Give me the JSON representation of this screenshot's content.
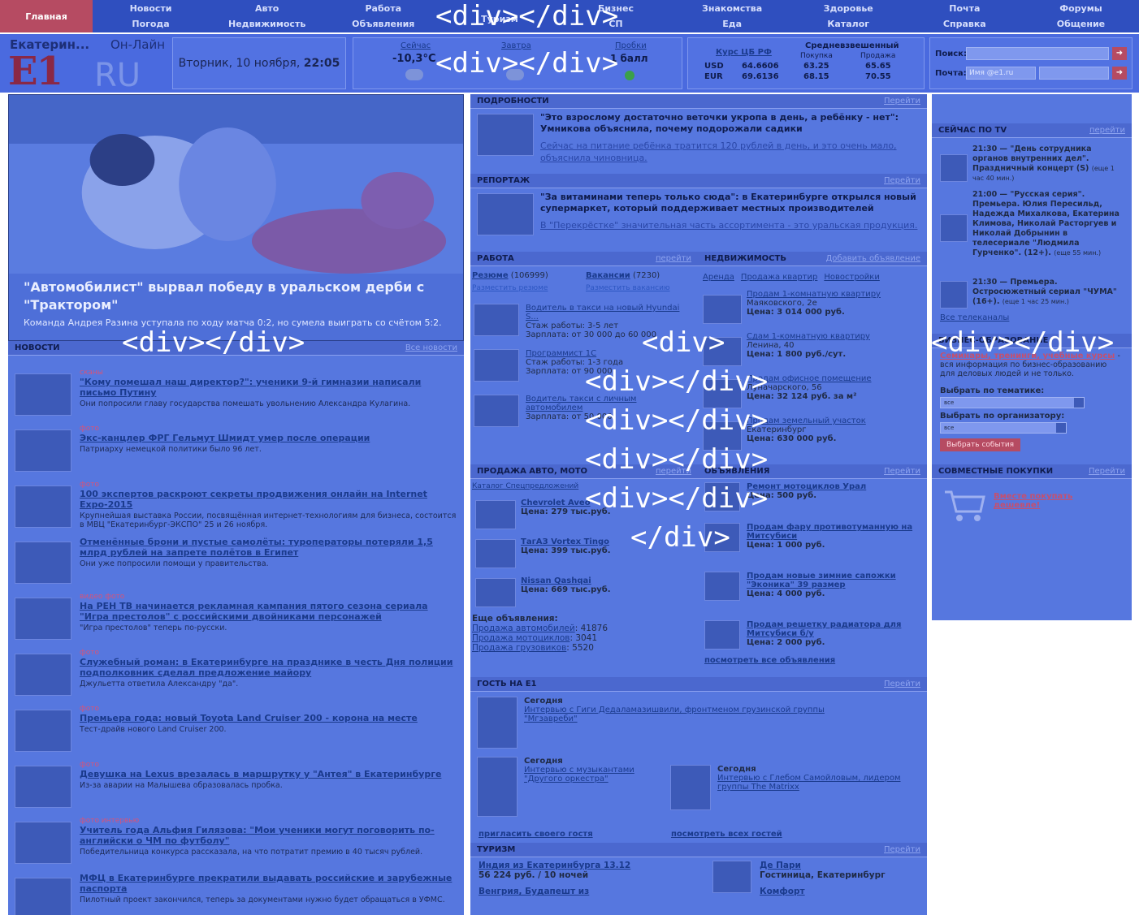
{
  "nav": {
    "home": "Главная",
    "columns": [
      [
        "Новости",
        "Погода"
      ],
      [
        "Авто",
        "Недвижимость"
      ],
      [
        "Работа",
        "Объявления"
      ],
      [
        "",
        "Туризм"
      ],
      [
        "Бизнес",
        "СП"
      ],
      [
        "Знакомства",
        "Еда"
      ],
      [
        "Здоровье",
        "Каталог"
      ],
      [
        "Почта",
        "Справка"
      ],
      [
        "Форумы",
        "Общение"
      ]
    ]
  },
  "header": {
    "city": "Екатерин...",
    "online": "Он-Лайн",
    "logo_e1": "E1",
    "logo_ru": "RU",
    "date": "Вторник, 10 ноября,",
    "time": "22:05",
    "weather": {
      "now_label": "Сейчас",
      "now_temp": "-10,3°C",
      "tomorrow_label": "Завтра",
      "traffic_label": "Пробки",
      "traffic_value": "1 балл"
    },
    "rates": {
      "cb_label": "Курс ЦБ РФ",
      "weighted_label": "Средневзвешенный",
      "buy": "Покупка",
      "sell": "Продажа",
      "rows": [
        {
          "cur": "USD",
          "cb": "64.6606",
          "buy": "63.25",
          "sell": "65.65"
        },
        {
          "cur": "EUR",
          "cb": "69.6136",
          "buy": "68.15",
          "sell": "70.55"
        }
      ]
    },
    "search_label": "Поиск:",
    "mail_label": "Почта:",
    "mail_placeholder": "Имя @e1.ru"
  },
  "hero": {
    "title": "\"Автомобилист\" вырвал победу в уральском дерби с \"Трактором\"",
    "lead": "Команда Андрея Разина уступала по ходу матча 0:2, но сумела выиграть со счётом 5:2."
  },
  "news": {
    "header": "НОВОСТИ",
    "more": "Все новости",
    "items": [
      {
        "tags": "сканы",
        "title": "\"Кому помешал наш директор?\": ученики 9-й гимназии написали письмо Путину",
        "desc": "Они попросили главу государства помешать увольнению Александра Кулагина."
      },
      {
        "tags": "фото",
        "title": "Экс-канцлер ФРГ Гельмут Шмидт умер после операции",
        "desc": "Патриарху немецкой политики было 96 лет."
      },
      {
        "tags": "фото",
        "title": "100 экспертов раскроют секреты продвижения онлайн на Internet Expo-2015",
        "desc": "Крупнейшая выставка России, посвящённая интернет-технологиям для бизнеса, состоится в МВЦ \"Екатеринбург-ЭКСПО\" 25 и 26 ноября."
      },
      {
        "tags": "",
        "title": "Отменённые брони и пустые самолёты: туроператоры потеряли 1,5 млрд рублей на запрете полётов в Египет",
        "desc": "Они уже попросили помощи у правительства."
      },
      {
        "tags": "видео фото",
        "title": "На РЕН ТВ начинается рекламная кампания пятого сезона сериала \"Игра престолов\" с российскими двойниками персонажей",
        "desc": "\"Игра престолов\" теперь по-русски."
      },
      {
        "tags": "фото",
        "title": "Служебный роман: в Екатеринбурге на празднике в честь Дня полиции подполковник сделал предложение майору",
        "desc": "Джульетта ответила Александру \"да\"."
      },
      {
        "tags": "фото",
        "title": "Премьера года: новый Toyota Land Cruiser 200 - корона на месте",
        "desc": "Тест-драйв нового Land Cruiser 200."
      },
      {
        "tags": "фото",
        "title": "Девушка на Lexus врезалась в маршрутку у \"Антея\" в Екатеринбурге",
        "desc": "Из-за аварии на Малышева образовалась пробка."
      },
      {
        "tags": "фото интервью",
        "title": "Учитель года Альфия Гилязова: \"Мои ученики могут поговорить по-английски о ЧМ по футболу\"",
        "desc": "Победительница конкурса рассказала, на что потратит премию в 40 тысяч рублей."
      },
      {
        "tags": "",
        "title": "МФЦ в Екатеринбурге прекратили выдавать российские и зарубежные паспорта",
        "desc": "Пилотный проект закончился, теперь за документами нужно будет обращаться в УФМС."
      }
    ]
  },
  "details": {
    "header": "ПОДРОБНОСТИ",
    "more": "Перейти",
    "title": "\"Это взрослому достаточно веточки укропа в день, а ребёнку - нет\": Умникова объяснила, почему подорожали садики",
    "sub": "Сейчас на питание ребёнка тратится 120 рублей в день, и это очень мало, объяснила чиновница."
  },
  "report": {
    "header": "РЕПОРТАЖ",
    "more": "Перейти",
    "title": "\"За витаминами теперь только сюда\": в Екатеринбурге открылся новый супермаркет, который поддерживает местных производителей",
    "sub": "В \"Перекрёстке\" значительная часть ассортимента - это уральская продукция."
  },
  "work": {
    "header": "РАБОТА",
    "more": "перейти",
    "resume": "Резюме",
    "resume_count": "(106999)",
    "vacancies": "Вакансии",
    "vacancies_count": "(7230)",
    "post_resume": "Разместить резюме",
    "post_vacancy": "Разместить вакансию",
    "jobs": [
      {
        "title": "Водитель в такси на новый Hyundai S...",
        "l1": "Стаж работы: 3-5 лет",
        "l2": "Зарплата: от 30 000 до 60 000"
      },
      {
        "title": "Программист 1С",
        "l1": "Стаж работы: 1-3 года",
        "l2": "Зарплата: от 90 000"
      },
      {
        "title": "Водитель такси с личным автомобилем",
        "l1": "Зарплата: от 50 000",
        "l2": ""
      }
    ]
  },
  "realty": {
    "header": "НЕДВИЖИМОСТЬ",
    "more": "Добавить объявление",
    "tabs": [
      "Аренда",
      "Продажа квартир",
      "Новостройки"
    ],
    "items": [
      {
        "title": "Продам 1-комнатную квартиру",
        "addr": "Маяковского, 2е",
        "price": "Цена: 3 014 000 руб."
      },
      {
        "title": "Сдам 1-комнатную квартиру",
        "addr": "Ленина, 40",
        "price": "Цена: 1 800 руб./сут."
      },
      {
        "title": "Продам офисное помещение",
        "addr": "Луначарского, 56",
        "price": "Цена: 32 124 руб. за м²"
      },
      {
        "title": "Продам земельный участок",
        "addr": "Екатеринбург",
        "price": "Цена: 630 000 руб."
      }
    ]
  },
  "auto": {
    "header": "ПРОДАЖА АВТО, МОТО",
    "more": "перейти",
    "catalog": "Каталог Спецпредложений",
    "cars": [
      {
        "name": "Chevrolet Aveo",
        "price": "Цена: 279 тыс.руб."
      },
      {
        "name": "ТагАЗ Vortex Tingo",
        "price": "Цена: 399 тыс.руб."
      },
      {
        "name": "Nissan Qashqai",
        "price": "Цена: 669 тыс.руб."
      }
    ],
    "more_title": "Еще объявления:",
    "more_links": [
      {
        "label": "Продажа автомобилей",
        "count": ": 41876"
      },
      {
        "label": "Продажа мотоциклов",
        "count": ": 3041"
      },
      {
        "label": "Продажа грузовиков",
        "count": ": 5520"
      }
    ]
  },
  "ads": {
    "header": "ОБЪЯВЛЕНИЯ",
    "more": "Перейти",
    "items": [
      {
        "title": "Ремонт мотоциклов Урал",
        "price": "Цена: 500 руб."
      },
      {
        "title": "Продам фару противотуманную на Митсубиси",
        "price": "Цена: 1 000 руб."
      },
      {
        "title": "Продам новые зимние сапожки \"Эконика\" 39 размер",
        "price": "Цена: 4 000 руб."
      },
      {
        "title": "Продам решетку радиатора для Митсубиси б/у",
        "price": "Цена: 2 000 руб."
      }
    ],
    "all": "посмотреть все объявления"
  },
  "guest": {
    "header": "ГОСТЬ НА Е1",
    "more": "Перейти",
    "items": [
      {
        "when": "Сегодня",
        "text": "Интервью с Гиги Дедаламазишвили, фронтменом грузинской группы \"Мгзавреби\""
      },
      {
        "when": "Сегодня",
        "text": "Интервью с музыкантами \"Другого оркестра\""
      },
      {
        "when": "Сегодня",
        "text": "Интервью с Глебом Самойловым, лидером группы The Matrixx"
      }
    ],
    "invite": "пригласить своего гостя",
    "all": "посмотреть всех гостей"
  },
  "tourism": {
    "header": "ТУРИЗМ",
    "more": "Перейти",
    "left_title": "Индия из Екатеринбурга 13.12",
    "left_price": "56 224 руб. / 10 ночей",
    "left_next": "Венгрия, Будапешт из",
    "right_title": "Де Пари",
    "right_sub": "Гостиница, Екатеринбург",
    "right_next": "Комфорт"
  },
  "tv": {
    "header": "СЕЙЧАС ПО TV",
    "more": "перейти",
    "items": [
      {
        "time": "21:30 — \"День сотрудника органов внутренних дел\". Праздничный концерт (S)",
        "note": "(еще 1 час 40 мин.)"
      },
      {
        "time": "21:00 — \"Русская серия\". Премьера. Юлия Пересильд, Надежда Михалкова, Екатерина Климова, Николай Расторгуев и Николай Добрынин в телесериале \"Людмила Гурченко\". (12+).",
        "note": "(еще 55 мин.)"
      },
      {
        "time": "21:30 — Премьера. Остросюжетный сериал \"ЧУМА\" (16+).",
        "note": "(еще 1 час 25 мин.)"
      }
    ],
    "all": "Все телеканалы"
  },
  "business": {
    "header": "БИЗНЕС-ОБРАЗОВАНИЕ",
    "link": "Семинары, тренинги, учебные курсы",
    "desc": "- вся информация по бизнес-образованию для деловых людей и не только.",
    "by_topic": "Выбрать по тематике:",
    "by_org": "Выбрать по организатору:",
    "select_value": "все",
    "button": "Выбрать события"
  },
  "joint": {
    "header": "СОВМЕСТНЫЕ ПОКУПКИ",
    "more": "Перейти",
    "link": "Вместе покупать дешевле!"
  },
  "overlay": {
    "div": "<div></div>",
    "open": "<div>",
    "close": "</div>"
  }
}
